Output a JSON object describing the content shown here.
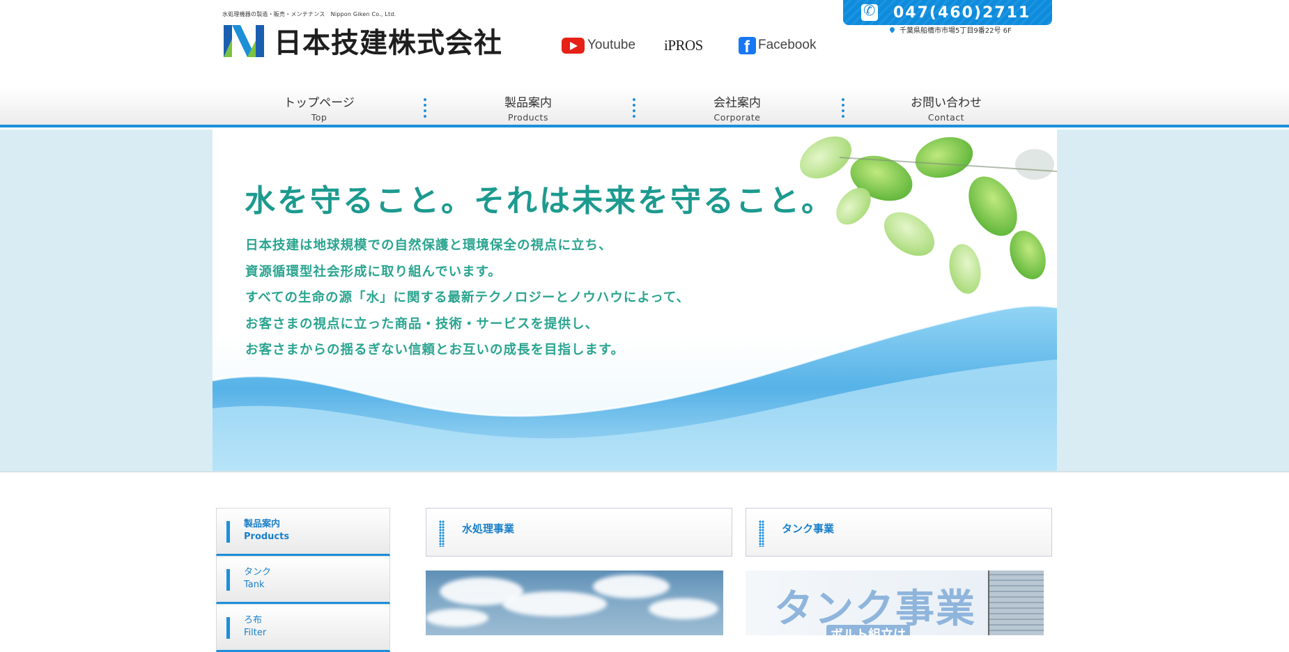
{
  "header": {
    "tagline": "水処理機器の製造・販売・メンテナンス　Nippon Giken Co., Ltd.",
    "company_name": "日本技建株式会社",
    "logo_icon": "nippon-giken-logo",
    "social": {
      "youtube_label": "Youtube",
      "ipros_label": "iPROS",
      "facebook_label": "Facebook"
    },
    "phone": "047(460)2711",
    "address": "千葉県船橋市市場5丁目9番22号 6F"
  },
  "nav": {
    "items": [
      {
        "jp": "トップページ",
        "en": "Top"
      },
      {
        "jp": "製品案内",
        "en": "Products"
      },
      {
        "jp": "会社案内",
        "en": "Corporate"
      },
      {
        "jp": "お問い合わせ",
        "en": "Contact"
      }
    ]
  },
  "hero": {
    "title": "水を守ること。それは未来を守ること。",
    "lines": [
      "日本技建は地球規模での自然保護と環境保全の視点に立ち、",
      "資源循環型社会形成に取り組んでいます。",
      "すべての生命の源「水」に関する最新テクノロジーとノウハウによって、",
      "お客さまの視点に立った商品・技術・サービスを提供し、",
      "お客さまからの揺るぎない信頼とお互いの成長を目指します。"
    ]
  },
  "sidebar": {
    "items": [
      {
        "jp": "製品案内",
        "en": "Products"
      },
      {
        "jp": "タンク",
        "en": "Tank"
      },
      {
        "jp": "ろ布",
        "en": "Filter"
      }
    ]
  },
  "panels": [
    {
      "title": "水処理事業"
    },
    {
      "title": "タンク事業",
      "image_title": "タンク事業",
      "image_sub": "ボルト組立は"
    }
  ],
  "colors": {
    "accent": "#1c8fdc",
    "hero_text": "#2aa490",
    "link": "#1a7fc9"
  }
}
